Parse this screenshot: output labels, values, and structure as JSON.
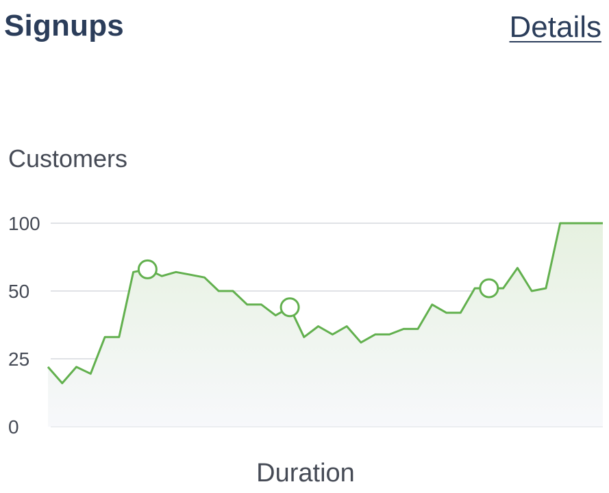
{
  "header": {
    "title": "Signups",
    "details_label": "Details"
  },
  "colors": {
    "title": "#2b3d5a",
    "line": "#62b04e",
    "grid": "#d5d8dd",
    "text": "#454a55"
  },
  "chart_data": {
    "type": "area",
    "ylabel": "Customers",
    "xlabel": "Duration",
    "ylim": [
      0,
      100
    ],
    "yticks": [
      0,
      25,
      50,
      100
    ],
    "grid": true,
    "x": [
      0,
      1,
      2,
      3,
      4,
      5,
      6,
      7,
      8,
      9,
      10,
      11,
      12,
      13,
      14,
      15,
      16,
      17,
      18,
      19,
      20,
      21,
      22,
      23,
      24,
      25,
      26,
      27,
      28,
      29,
      30,
      31,
      32,
      33,
      34,
      35,
      36,
      37,
      38,
      39
    ],
    "series": [
      {
        "values": [
          22,
          16,
          22,
          19.5,
          33,
          33,
          64,
          66,
          61,
          64,
          62,
          60,
          50,
          50,
          45,
          45,
          41,
          44,
          33,
          37,
          34,
          37,
          31,
          34,
          34,
          36,
          36,
          45,
          42,
          42,
          52,
          52,
          52,
          67,
          50,
          52,
          100,
          100,
          100,
          100
        ],
        "markers": [
          7,
          17,
          31
        ]
      }
    ]
  }
}
